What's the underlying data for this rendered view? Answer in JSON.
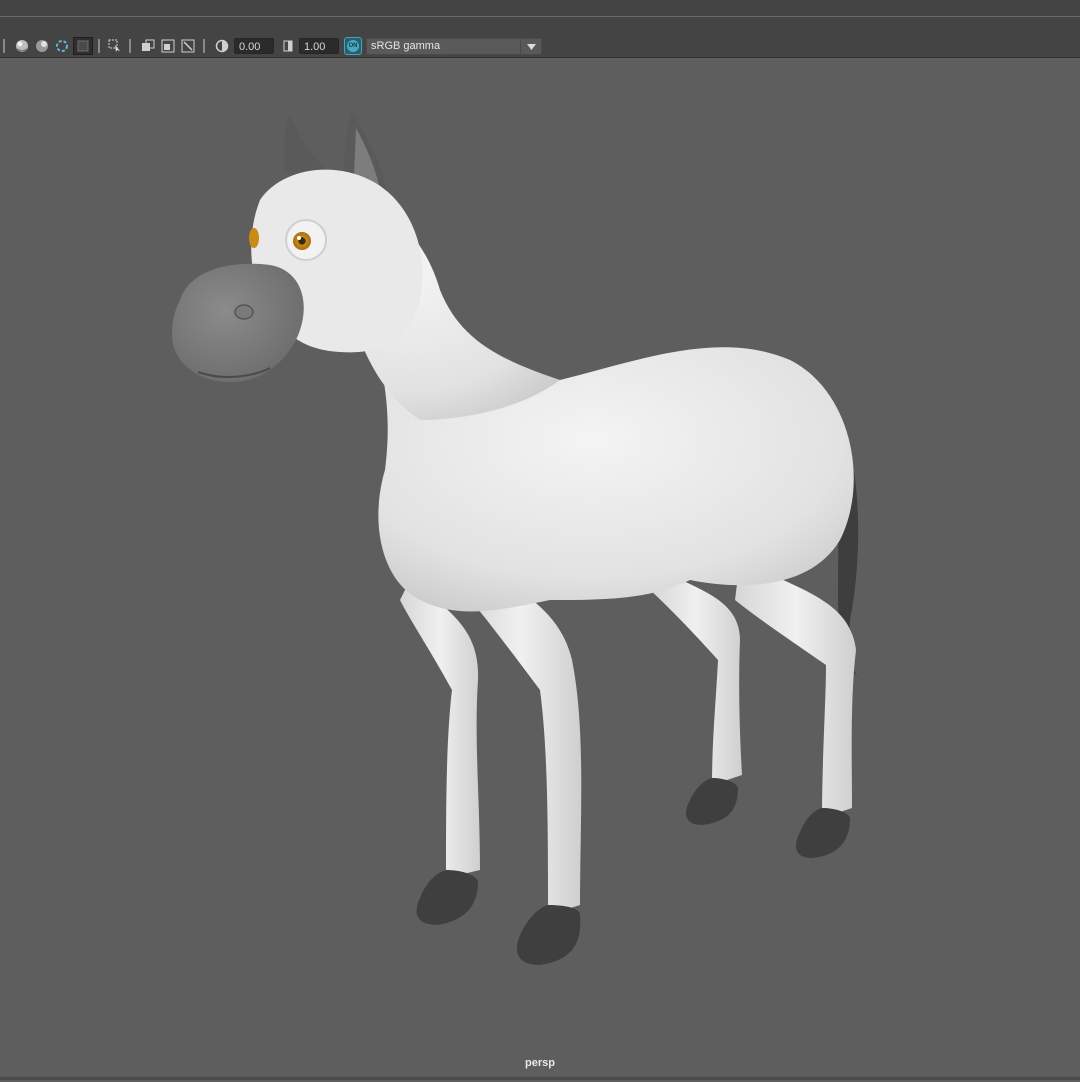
{
  "toolbar": {
    "icons": [
      "sep-handle",
      "shaded-sphere-icon",
      "textured-sphere-icon",
      "isolate-icon",
      "grid-icon",
      "select-camera-icon",
      "two-pane-icon",
      "film-gate-icon",
      "resolution-gate-icon",
      "exposure-icon",
      "gamma-icon",
      "color-management-icon"
    ],
    "exposure_value": "0.00",
    "gamma_value": "1.00",
    "color_space": "sRGB gamma"
  },
  "viewport": {
    "camera_label": "persp",
    "background_color": "#5e5e5e",
    "model_color": "#e6e6e6",
    "accent_dark": "#3f3f3f",
    "eye_color": "#c98a18"
  }
}
